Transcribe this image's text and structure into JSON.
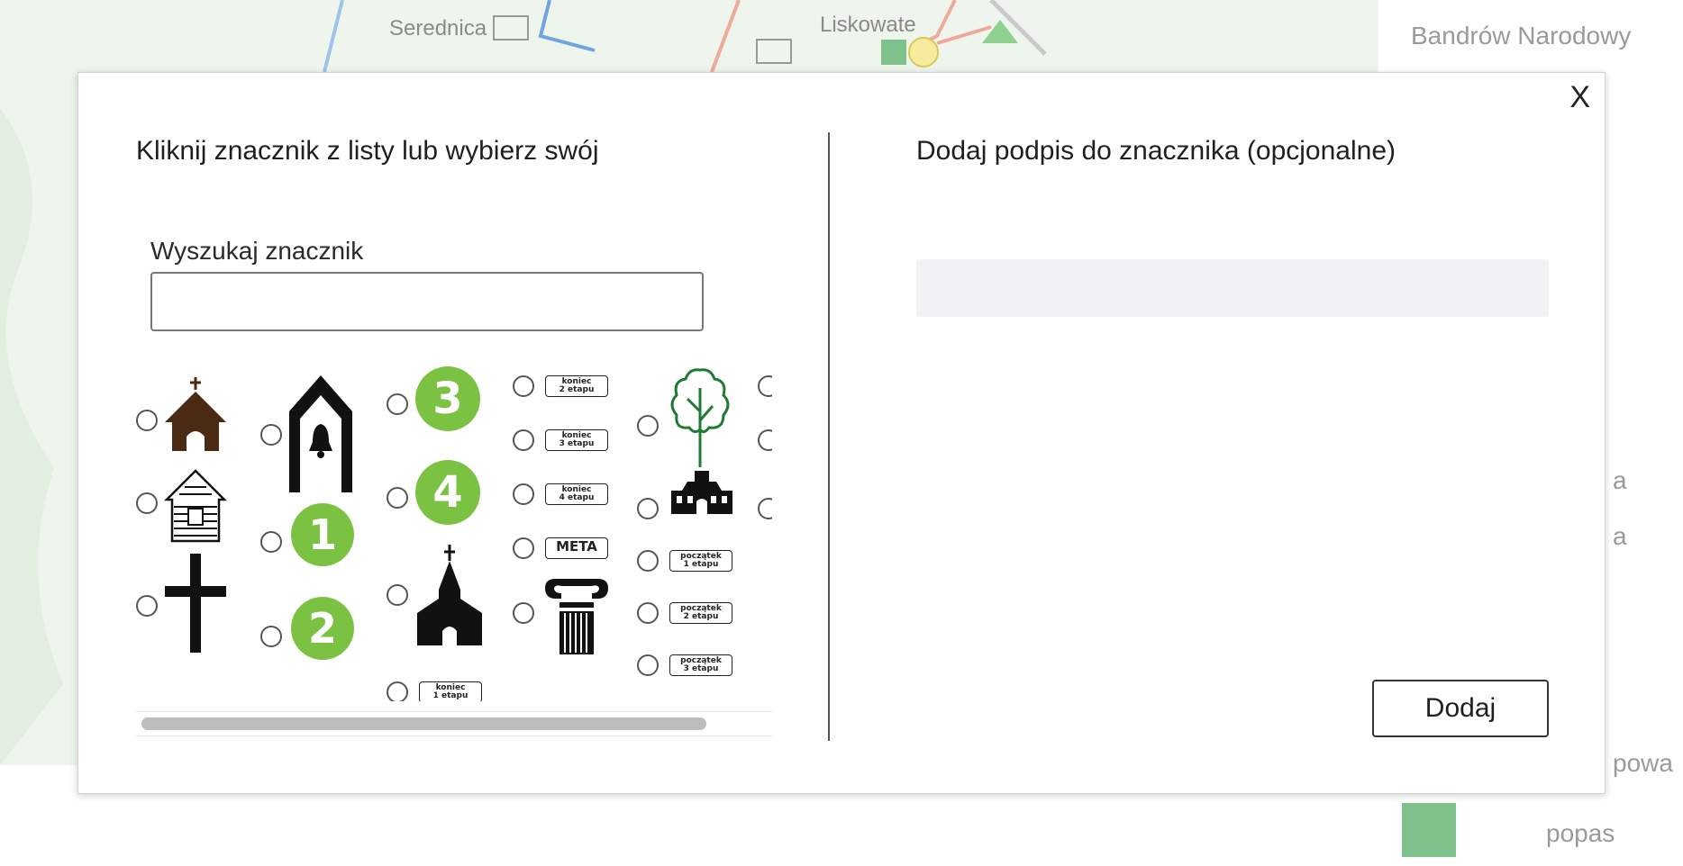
{
  "background": {
    "map_labels": [
      "Serednica",
      "Liskowate"
    ],
    "legend_labels": [
      "Bandrów Narodowy",
      "a",
      "a",
      "powa",
      "popas"
    ]
  },
  "modal": {
    "close_label": "X",
    "left_title": "Kliknij znacznik z listy lub wybierz swój",
    "search_label": "Wyszukaj znacznik",
    "search_value": "",
    "search_placeholder": "",
    "right_title": "Dodaj podpis do znacznika (opcjonalne)",
    "caption_value": "",
    "caption_placeholder": "",
    "add_button": "Dodaj",
    "markers": {
      "numbers": [
        "1",
        "2",
        "3",
        "4"
      ],
      "tags": {
        "koniec_1": [
          "koniec",
          "1 etapu"
        ],
        "koniec_2": [
          "koniec",
          "2 etapu"
        ],
        "koniec_3": [
          "koniec",
          "3 etapu"
        ],
        "koniec_4": [
          "koniec",
          "4 etapu"
        ],
        "meta": "META",
        "poczatek_1": [
          "początek",
          "1 etapu"
        ],
        "poczatek_2": [
          "początek",
          "2 etapu"
        ],
        "poczatek_3": [
          "początek",
          "3 etapu"
        ]
      }
    },
    "colors": {
      "badge_green": "#7cc242",
      "church_brown": "#4a2a12",
      "tree_green": "#1f7a34"
    }
  }
}
